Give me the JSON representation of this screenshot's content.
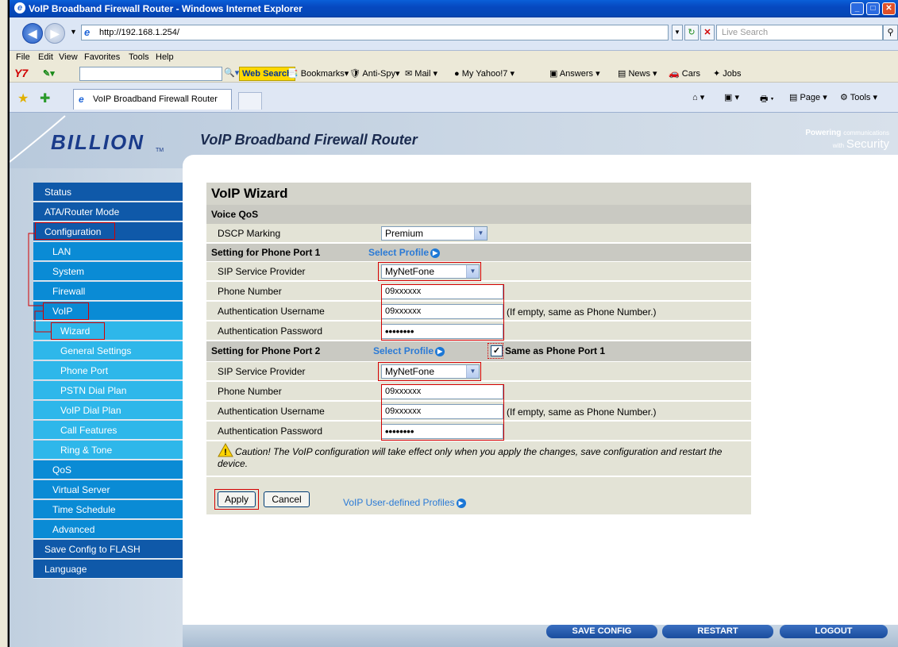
{
  "browser": {
    "title": "VoIP Broadband Firewall Router - Windows Internet Explorer",
    "url": "http://192.168.1.254/",
    "search_placeholder": "Live Search",
    "menu": [
      "File",
      "Edit",
      "View",
      "Favorites",
      "Tools",
      "Help"
    ],
    "toolbar": {
      "logo": "Y7",
      "web_search": "Web Search",
      "bookmarks": "Bookmarks",
      "antispy": "Anti-Spy",
      "mail": "Mail",
      "myyahoo": "My Yahoo!7",
      "answers": "Answers",
      "news": "News",
      "cars": "Cars",
      "jobs": "Jobs"
    },
    "tab_title": "VoIP Broadband Firewall Router",
    "right_tools": {
      "page": "Page",
      "tools": "Tools"
    }
  },
  "router": {
    "brand": "BILLION",
    "tm": "TM",
    "title": "VoIP Broadband Firewall Router",
    "tag_line1": "Powering",
    "tag_line1b": "communications",
    "tag_line2a": "with",
    "tag_line2b": "Security",
    "bottom_buttons": [
      "SAVE CONFIG",
      "RESTART",
      "LOGOUT"
    ]
  },
  "menu": [
    {
      "label": "Status",
      "level": "dark"
    },
    {
      "label": "ATA/Router Mode",
      "level": "dark"
    },
    {
      "label": "Configuration",
      "level": "dark"
    },
    {
      "label": "LAN",
      "level": "mid"
    },
    {
      "label": "System",
      "level": "mid"
    },
    {
      "label": "Firewall",
      "level": "mid"
    },
    {
      "label": "VoIP",
      "level": "mid"
    },
    {
      "label": "Wizard",
      "level": "light"
    },
    {
      "label": "General Settings",
      "level": "light"
    },
    {
      "label": "Phone Port",
      "level": "light"
    },
    {
      "label": "PSTN Dial Plan",
      "level": "light"
    },
    {
      "label": "VoIP Dial Plan",
      "level": "light"
    },
    {
      "label": "Call Features",
      "level": "light"
    },
    {
      "label": "Ring & Tone",
      "level": "light"
    },
    {
      "label": "QoS",
      "level": "mid"
    },
    {
      "label": "Virtual Server",
      "level": "mid"
    },
    {
      "label": "Time Schedule",
      "level": "mid"
    },
    {
      "label": "Advanced",
      "level": "mid"
    },
    {
      "label": "Save Config to FLASH",
      "level": "dark"
    },
    {
      "label": "Language",
      "level": "dark"
    }
  ],
  "wizard": {
    "heading": "VoIP Wizard",
    "voice_qos": "Voice QoS",
    "dscp_label": "DSCP Marking",
    "dscp_value": "Premium",
    "port1_heading": "Setting for Phone Port 1",
    "select_profile": "Select Profile",
    "port1": {
      "sip_label": "SIP Service Provider",
      "sip_value": "MyNetFone",
      "phone_label": "Phone Number",
      "phone_value": "09xxxxxx",
      "user_label": "Authentication Username",
      "user_value": "09xxxxxx",
      "user_note": "(If empty, same as Phone Number.)",
      "pass_label": "Authentication Password",
      "pass_value": "••••••••"
    },
    "port2_heading": "Setting for Phone Port 2",
    "same_as": "Same as Phone Port 1",
    "port2": {
      "sip_label": "SIP Service Provider",
      "sip_value": "MyNetFone",
      "phone_label": "Phone Number",
      "phone_value": "09xxxxxx",
      "user_label": "Authentication Username",
      "user_value": "09xxxxxx",
      "user_note": "(If empty, same as Phone Number.)",
      "pass_label": "Authentication Password",
      "pass_value": "••••••••"
    },
    "caution": "Caution! The VoIP configuration will take effect only when you apply the changes, save configuration and restart the device.",
    "apply": "Apply",
    "cancel": "Cancel",
    "user_profiles": "VoIP User-defined Profiles"
  }
}
